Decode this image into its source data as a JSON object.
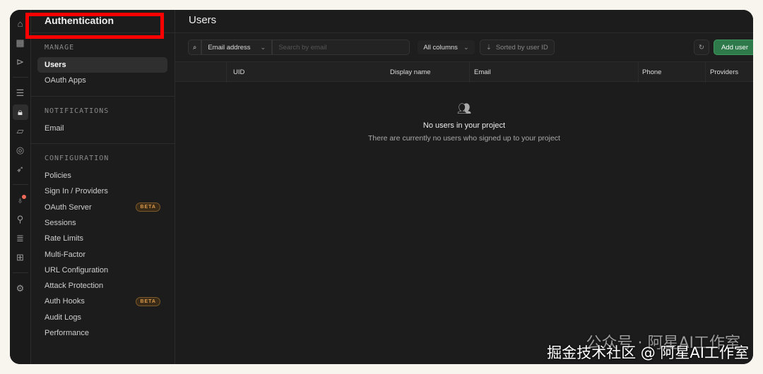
{
  "sidebar": {
    "title": "Authentication",
    "manage": {
      "header": "MANAGE",
      "items": [
        "Users",
        "OAuth Apps"
      ]
    },
    "notifications": {
      "header": "NOTIFICATIONS",
      "items": [
        "Email"
      ]
    },
    "configuration": {
      "header": "CONFIGURATION",
      "items": [
        "Policies",
        "Sign In / Providers",
        "OAuth Server",
        "Sessions",
        "Rate Limits",
        "Multi-Factor",
        "URL Configuration",
        "Attack Protection",
        "Auth Hooks",
        "Audit Logs",
        "Performance"
      ],
      "beta_label": "BETA"
    }
  },
  "main": {
    "title": "Users",
    "toolbar": {
      "search_field": "Email address",
      "search_placeholder": "Search by email",
      "columns": "All columns",
      "sort": "Sorted by user ID",
      "add_user": "Add user"
    },
    "columns": [
      "UID",
      "Display name",
      "Email",
      "Phone",
      "Providers"
    ],
    "empty": {
      "title": "No users in your project",
      "subtitle": "There are currently no users who signed up to your project"
    }
  },
  "watermark": {
    "line1": "公众号 · 阿星AI工作室",
    "line2": "掘金技术社区 @ 阿星AI工作室"
  },
  "colors": {
    "accent": "#2f7a4a",
    "highlight": "#ff0000"
  }
}
